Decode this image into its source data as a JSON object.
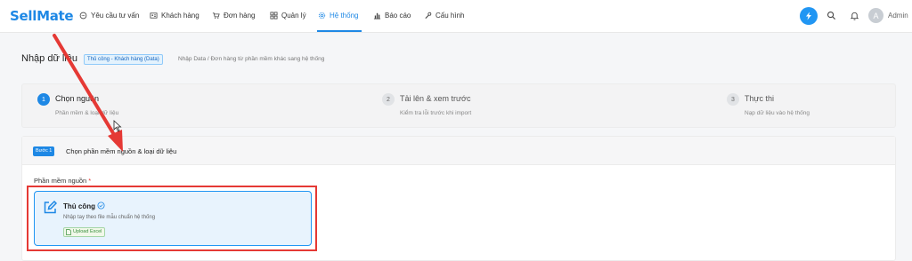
{
  "brand": {
    "name_prefix": "Sell",
    "name_suffix": "Mate",
    "accent": "#1e88e5"
  },
  "nav": {
    "items": [
      {
        "label": "Yêu cầu tư vấn",
        "icon": "chat-icon"
      },
      {
        "label": "Khách hàng",
        "icon": "contact-card-icon"
      },
      {
        "label": "Đơn hàng",
        "icon": "cart-icon"
      },
      {
        "label": "Quản lý",
        "icon": "grid-icon"
      },
      {
        "label": "Hệ thống",
        "icon": "gear-icon",
        "active": true
      },
      {
        "label": "Báo cáo",
        "icon": "bar-chart-icon"
      },
      {
        "label": "Cấu hình",
        "icon": "wrench-icon"
      }
    ],
    "user_initial": "A",
    "user_name": "Admin"
  },
  "page": {
    "title": "Nhập dữ liệu",
    "tag": "Thủ công - Khách hàng (Data)",
    "breadcrumb": "Nhập Data / Đơn hàng từ phần mềm khác sang hệ thống"
  },
  "steps": [
    {
      "number": "1",
      "title": "Chọn nguồn",
      "subtitle": "Phần mềm & loại dữ liệu",
      "active": true
    },
    {
      "number": "2",
      "title": "Tải lên & xem trước",
      "subtitle": "Kiểm tra lỗi trước khi import",
      "active": false
    },
    {
      "number": "3",
      "title": "Thực thi",
      "subtitle": "Nạp dữ liệu vào hệ thống",
      "active": false
    }
  ],
  "step_card": {
    "badge": "Bước 1",
    "title": "Chọn phần mềm nguồn & loại dữ liệu",
    "field_label": "Phần mềm nguồn",
    "required_mark": "*",
    "source_option": {
      "title": "Thủ công",
      "description": "Nhập tay theo file mẫu chuẩn hệ thống",
      "tag": "Upload Excel",
      "selected": true
    }
  },
  "annotation_color": "#e53935"
}
